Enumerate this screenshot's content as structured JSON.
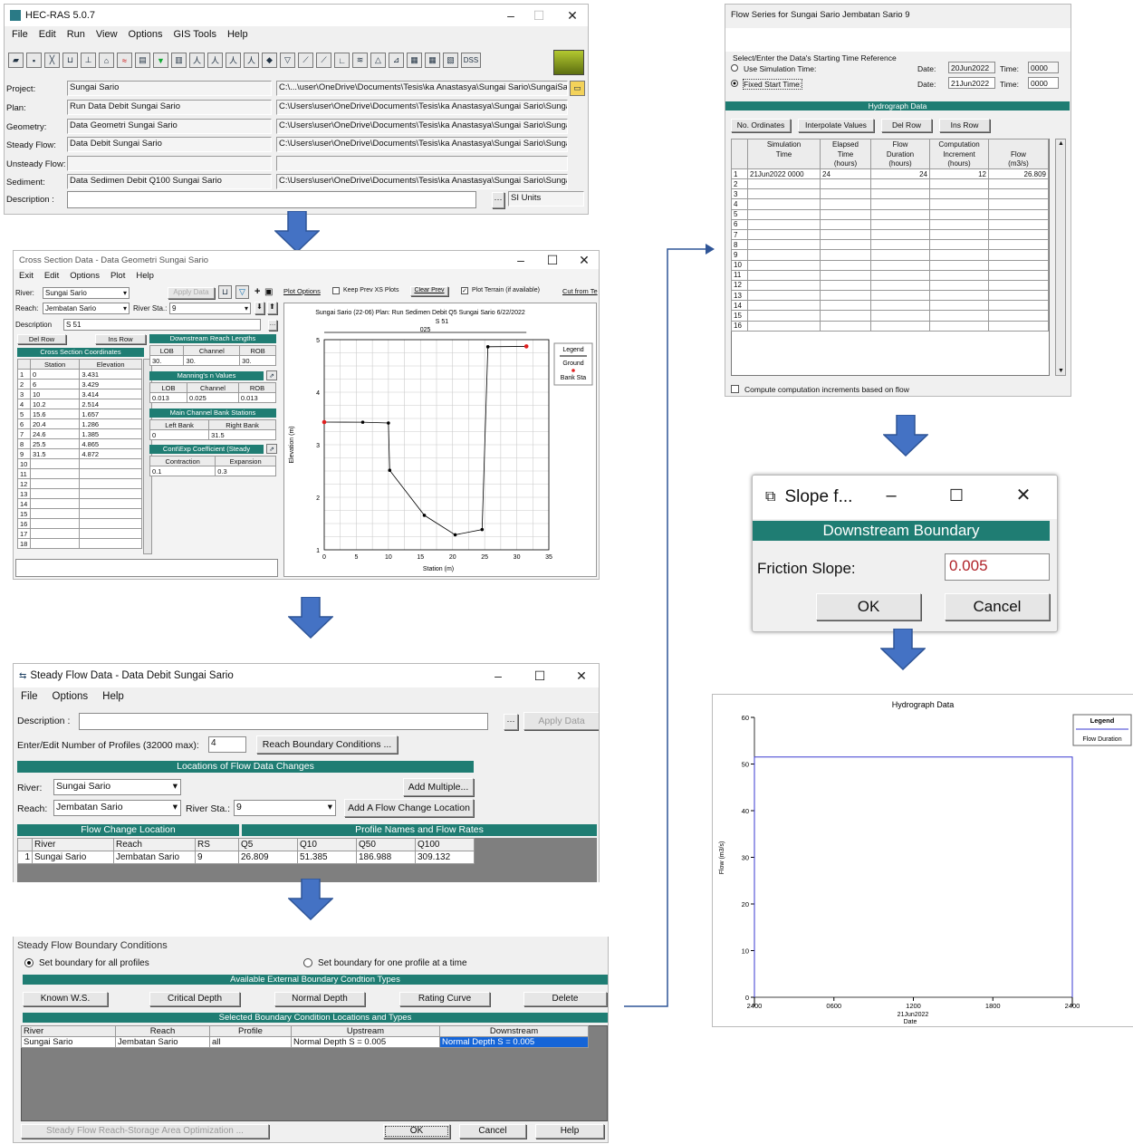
{
  "main": {
    "title": "HEC-RAS 5.0.7",
    "menu": [
      "File",
      "Edit",
      "Run",
      "View",
      "Options",
      "GIS Tools",
      "Help"
    ],
    "dss": "DSS",
    "rows": [
      {
        "label": "Project:",
        "name": "Sungai Sario",
        "path": "C:\\...\\user\\OneDrive\\Documents\\Tesis\\ka Anastasya\\Sungai Sario\\SungaiSario.prj"
      },
      {
        "label": "Plan:",
        "name": "Run Data Debit Sungai Sario",
        "path": "C:\\Users\\user\\OneDrive\\Documents\\Tesis\\ka Anastasya\\Sungai Sario\\SungaiSario.p01"
      },
      {
        "label": "Geometry:",
        "name": "Data Geometri Sungai Sario",
        "path": "C:\\Users\\user\\OneDrive\\Documents\\Tesis\\ka Anastasya\\Sungai Sario\\SungaiSario.g01"
      },
      {
        "label": "Steady Flow:",
        "name": "Data Debit Sungai Sario",
        "path": "C:\\Users\\user\\OneDrive\\Documents\\Tesis\\ka Anastasya\\Sungai Sario\\SungaiSario.f01"
      },
      {
        "label": "Unsteady Flow:",
        "name": "",
        "path": ""
      },
      {
        "label": "Sediment:",
        "name": "Data Sedimen Debit Q100 Sungai Sario",
        "path": "C:\\Users\\user\\OneDrive\\Documents\\Tesis\\ka Anastasya\\Sungai Sario\\SungaiSario.s04"
      }
    ],
    "desc_label": "Description :",
    "units": "SI Units"
  },
  "xs": {
    "title": "Cross Section Data - Data Geometri Sungai Sario",
    "menu": [
      "Exit",
      "Edit",
      "Options",
      "Plot",
      "Help"
    ],
    "river_label": "River:",
    "river": "Sungai Sario",
    "reach_label": "Reach:",
    "reach": "Jembatan Sario",
    "rs_label": "River Sta.:",
    "rs": "9",
    "desc_label": "Description",
    "desc": "S 51",
    "apply": "Apply Data",
    "plot_options": "Plot Options",
    "keep_prev": "Keep Prev XS Plots",
    "clear_prev": "Clear Prev",
    "plot_terrain": "Plot Terrain (if available)",
    "cut_from": "Cut from Te",
    "del_row": "Del Row",
    "ins_row": "Ins Row",
    "coords_title": "Cross Section Coordinates",
    "station_h": "Station",
    "elev_h": "Elevation",
    "coords": [
      [
        "1",
        "0",
        "3.431"
      ],
      [
        "2",
        "6",
        "3.429"
      ],
      [
        "3",
        "10",
        "3.414"
      ],
      [
        "4",
        "10.2",
        "2.514"
      ],
      [
        "5",
        "15.6",
        "1.657"
      ],
      [
        "6",
        "20.4",
        "1.286"
      ],
      [
        "7",
        "24.6",
        "1.385"
      ],
      [
        "8",
        "25.5",
        "4.865"
      ],
      [
        "9",
        "31.5",
        "4.872"
      ],
      [
        "10",
        "",
        ""
      ],
      [
        "11",
        "",
        ""
      ],
      [
        "12",
        "",
        ""
      ],
      [
        "13",
        "",
        ""
      ],
      [
        "14",
        "",
        ""
      ],
      [
        "15",
        "",
        ""
      ],
      [
        "16",
        "",
        ""
      ],
      [
        "17",
        "",
        ""
      ],
      [
        "18",
        "",
        ""
      ]
    ],
    "ds_title": "Downstream Reach Lengths",
    "lob": "LOB",
    "channel": "Channel",
    "rob": "ROB",
    "ds_vals": [
      "30.",
      "30.",
      "30."
    ],
    "mann_title": "Manning's n Values",
    "mann_vals": [
      "0.013",
      "0.025",
      "0.013"
    ],
    "bank_title": "Main Channel Bank Stations",
    "left_bank": "Left Bank",
    "right_bank": "Right Bank",
    "bank_vals": [
      "0",
      "31.5"
    ],
    "ce_title": "Cont\\Exp Coefficient (Steady",
    "contraction": "Contraction",
    "expansion": "Expansion",
    "ce_vals": [
      "0.1",
      "0.3"
    ],
    "plot_title": "Sungai Sario (22-06)     Plan: Run Sedimen Debit Q5 Sungai Sario   6/22/2022",
    "plot_sub": "S 51",
    "dim": "025",
    "ylabel": "Elevation (m)",
    "xlabel": "Station (m)",
    "legend": "Legend",
    "legend_ground": "Ground",
    "legend_bank": "Bank Sta",
    "xticks": [
      "0",
      "5",
      "10",
      "15",
      "20",
      "25",
      "30",
      "35"
    ],
    "yticks": [
      "1",
      "2",
      "3",
      "4",
      "5"
    ]
  },
  "sf": {
    "title": "Steady Flow Data - Data Debit Sungai Sario",
    "menu": [
      "File",
      "Options",
      "Help"
    ],
    "desc_label": "Description :",
    "apply": "Apply Data",
    "nprof_label": "Enter/Edit Number of Profiles (32000 max):",
    "nprof": "4",
    "reach_bc": "Reach Boundary Conditions ...",
    "loc_title": "Locations of Flow Data Changes",
    "river_label": "River:",
    "river": "Sungai Sario",
    "add_multiple": "Add Multiple...",
    "reach_label": "Reach:",
    "reach": "Jembatan Sario",
    "rs_label": "River Sta.:",
    "rs": "9",
    "add_change": "Add A Flow Change Location",
    "fcl_title": "Flow Change Location",
    "prof_title": "Profile Names and Flow Rates",
    "headers": [
      "River",
      "Reach",
      "RS",
      "Q5",
      "Q10",
      "Q50",
      "Q100"
    ],
    "row": [
      "1",
      "Sungai Sario",
      "Jembatan Sario",
      "9",
      "26.809",
      "51.385",
      "186.988",
      "309.132"
    ]
  },
  "bc": {
    "title": "Steady Flow Boundary Conditions",
    "opt_all": "Set boundary for all profiles",
    "opt_one": "Set boundary for one profile at a time",
    "avail_title": "Available External Boundary Condtion Types",
    "types": [
      "Known W.S.",
      "Critical Depth",
      "Normal Depth",
      "Rating Curve",
      "Delete"
    ],
    "sel_title": "Selected Boundary Condition Locations and Types",
    "headers": [
      "River",
      "Reach",
      "Profile",
      "Upstream",
      "Downstream"
    ],
    "row": [
      "Sungai Sario",
      "Jembatan Sario",
      "all",
      "Normal Depth S = 0.005",
      "Normal Depth S = 0.005"
    ],
    "opt_btn": "Steady Flow Reach-Storage Area Optimization ...",
    "ok": "OK",
    "cancel": "Cancel",
    "help": "Help"
  },
  "fs": {
    "title": "Flow Series for Sungai Sario Jembatan Sario 9",
    "time_ref": "Select/Enter the Data's Starting Time Reference",
    "use_sim": "Use Simulation Time:",
    "fixed": "Fixed Start Time:",
    "date_label": "Date:",
    "time_label": "Time:",
    "date1": "20Jun2022",
    "time1": "0000",
    "date2": "21Jun2022",
    "time2": "0000",
    "hydro_title": "Hydrograph Data",
    "btns": [
      "No. Ordinates",
      "Interpolate Values",
      "Del Row",
      "Ins Row"
    ],
    "h1": [
      "",
      "Simulation",
      "Elapsed",
      "Flow",
      "Computation",
      ""
    ],
    "h2": [
      "",
      "Time",
      "Time",
      "Duration",
      "Increment",
      "Flow"
    ],
    "h3": [
      "",
      "",
      "(hours)",
      "(hours)",
      "(hours)",
      "(m3/s)"
    ],
    "row1": [
      "1",
      "21Jun2022 0000",
      "24",
      "24",
      "12",
      "26.809"
    ],
    "rownums": [
      "2",
      "3",
      "4",
      "5",
      "6",
      "7",
      "8",
      "9",
      "10",
      "11",
      "12",
      "13",
      "14",
      "15",
      "16"
    ],
    "compute": "Compute computation increments based on flow"
  },
  "slope": {
    "title": "Slope f...",
    "header": "Downstream Boundary",
    "label": "Friction Slope:",
    "value": "0.005",
    "ok": "OK",
    "cancel": "Cancel"
  },
  "hg": {
    "title": "Hydrograph Data",
    "ylabel": "Flow (m3/s)",
    "legend": "Legend",
    "legend_item": "Flow Duration",
    "yticks": [
      "0",
      "10",
      "20",
      "30",
      "40",
      "50",
      "60"
    ],
    "xticks": [
      "2400",
      "0600",
      "1200",
      "1800",
      "2400"
    ],
    "xdate": "21Jun2022",
    "xlabel": "Date",
    "chart_data": {
      "type": "line",
      "series": [
        {
          "name": "Flow Duration",
          "x": [
            "2400",
            "2400",
            "2400",
            "2400"
          ],
          "y": [
            0,
            51.5,
            51.5,
            0
          ]
        }
      ],
      "ylim": [
        0,
        60
      ],
      "ylabel": "Flow (m3/s)",
      "xlabel": "Date"
    }
  }
}
